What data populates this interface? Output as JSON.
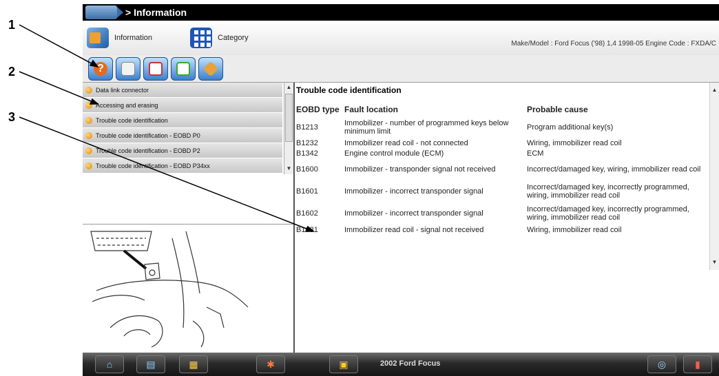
{
  "callouts": [
    "1",
    "2",
    "3"
  ],
  "window": {
    "title": "> Information"
  },
  "toolbar1": {
    "information_label": "Information",
    "category_label": "Category",
    "vehicle_info": "Make/Model : Ford Focus ('98) 1,4 1998-05   Engine Code : FXDA/C"
  },
  "toolbar2": {
    "icons": [
      "help-icon",
      "print-icon",
      "save-icon",
      "clear-icon",
      "tools-icon"
    ]
  },
  "topics": [
    {
      "label": "Data link connector"
    },
    {
      "label": "Accessing and erasing"
    },
    {
      "label": "Trouble code identification"
    },
    {
      "label": "Trouble code identification - EOBD P0"
    },
    {
      "label": "Trouble code identification - EOBD P2"
    },
    {
      "label": "Trouble code identification - EOBD P34xx"
    }
  ],
  "content": {
    "title": "Trouble code identification",
    "columns": {
      "code": "EOBD type",
      "location": "Fault location",
      "cause": "Probable cause"
    },
    "rows": [
      {
        "code": "B1213",
        "location": "Immobilizer - number of programmed keys below minimum limit",
        "cause": "Program additional key(s)"
      },
      {
        "code": "B1232",
        "location": "Immobilizer read coil - not connected",
        "cause": "Wiring, immobilizer read coil"
      },
      {
        "code": "B1342",
        "location": "Engine control module (ECM)",
        "cause": "ECM"
      },
      {
        "code": "B1600",
        "location": "Immobilizer - transponder signal not received",
        "cause": "Incorrect/damaged key, wiring, immobilizer read coil"
      },
      {
        "code": "B1601",
        "location": "Immobilizer - incorrect transponder signal",
        "cause": "Incorrect/damaged key, incorrectly programmed, wiring, immobilizer read coil"
      },
      {
        "code": "B1602",
        "location": "Immobilizer - incorrect transponder signal",
        "cause": "Incorrect/damaged key, incorrectly programmed, wiring, immobilizer read coil"
      },
      {
        "code": "B1681",
        "location": "Immobilizer read coil - signal not received",
        "cause": "Wiring, immobilizer read coil"
      }
    ]
  },
  "taskbar": {
    "vehicle": "2002 Ford Focus"
  },
  "colors": {
    "titlebar": "#000000",
    "topic_bullet": "#f0a020",
    "taskbar": "#1a1a1a"
  }
}
